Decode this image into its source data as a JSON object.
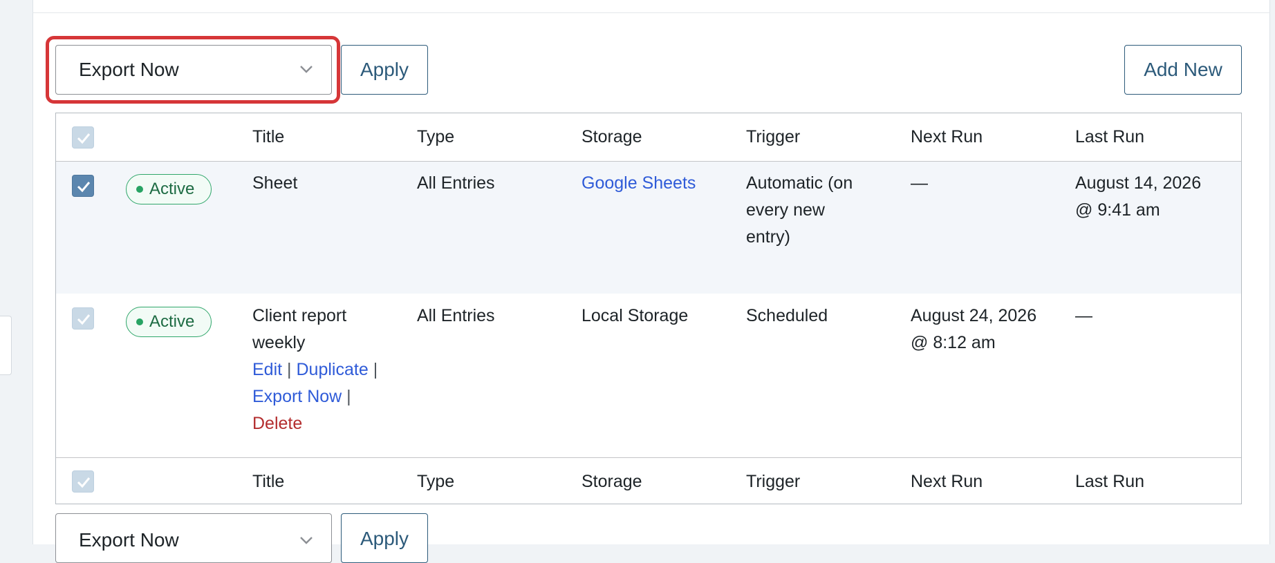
{
  "bulk_actions": {
    "selected_value": "Export Now",
    "apply_label": "Apply"
  },
  "add_new_label": "Add New",
  "columns": {
    "title": "Title",
    "type": "Type",
    "storage": "Storage",
    "trigger": "Trigger",
    "next_run": "Next Run",
    "last_run": "Last Run"
  },
  "rows": [
    {
      "status": "Active",
      "title": "Sheet",
      "type": "All Entries",
      "storage": "Google Sheets",
      "trigger": [
        "Automatic (on",
        "every new",
        "entry)"
      ],
      "next_run": [
        "—"
      ],
      "last_run": [
        "August 14, 2026",
        "@ 9:41 am"
      ],
      "checked": true
    },
    {
      "status": "Active",
      "title": [
        "Client report",
        "weekly"
      ],
      "type": "All Entries",
      "storage": "Local Storage",
      "trigger": [
        "Scheduled"
      ],
      "next_run": [
        "August 24, 2026",
        "@ 8:12 am"
      ],
      "last_run": [
        "—"
      ],
      "row_actions": {
        "edit": "Edit",
        "duplicate": "Duplicate",
        "export_now": "Export Now",
        "delete": "Delete",
        "separator": "|"
      },
      "checked": false
    }
  ],
  "colors": {
    "highlight": "#d63638",
    "button_border": "#2c5a7a",
    "link": "#2f5bd8",
    "delete": "#b32d2e",
    "active_badge": "#2fa66a"
  }
}
